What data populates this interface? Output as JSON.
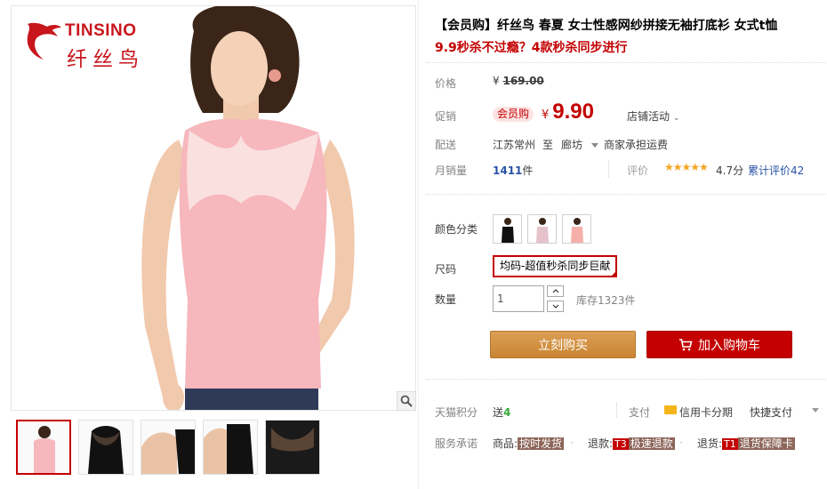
{
  "gallery": {
    "brand_en": "TINSINO",
    "brand_cn": "纤丝鸟",
    "zoom_icon": "magnifier-icon",
    "thumbnails": [
      "pink-top-front",
      "black-mesh-yoke",
      "arm-detail",
      "black-side",
      "black-mesh-detail"
    ]
  },
  "product": {
    "title": "【会员购】纤丝鸟 春夏 女士性感网纱拼接无袖打底衫 女式t恤",
    "subtitle": "9.9秒杀不过瘾？4款秒杀同步进行"
  },
  "price": {
    "label": "价格",
    "currency": "¥",
    "original": "169.00"
  },
  "promo": {
    "label": "促销",
    "badge": "会员购",
    "currency": "¥",
    "price": "9.90",
    "store_activity": "店铺活动"
  },
  "shipping": {
    "label": "配送",
    "from": "江苏常州",
    "to_word": "至",
    "destination": "廊坊",
    "fee": "商家承担运费"
  },
  "sales": {
    "label": "月销量",
    "count": "1411",
    "unit": "件",
    "rating_label": "评价",
    "stars": "★★★★★",
    "score": "4.7分",
    "reviews": "累计评价42"
  },
  "options": {
    "color_label": "颜色分类",
    "size_label": "尺码",
    "size_value": "均码-超值秒杀同步巨献",
    "qty_label": "数量",
    "qty_value": "1",
    "stock": "库存1323件"
  },
  "actions": {
    "buy": "立刻购买",
    "cart": "加入购物车"
  },
  "footer": {
    "points_label": "天猫积分",
    "points_prefix": "送",
    "points_value": "4",
    "pay_label": "支付",
    "pay_credit": "信用卡分期",
    "pay_quick": "快捷支付",
    "service_label": "服务承诺",
    "svc1_text": "商品:",
    "svc1_tag": "按时发货",
    "svc2_text": "退款:",
    "svc2_code": "T3",
    "svc2_tag": "极速退款",
    "svc3_text": "退货:",
    "svc3_code": "T1",
    "svc3_tag": "退货保障卡"
  },
  "colors": {
    "accent": "#c40000",
    "buy_button": "#d58f3f",
    "link": "#2953a6",
    "star": "#f5a623"
  }
}
